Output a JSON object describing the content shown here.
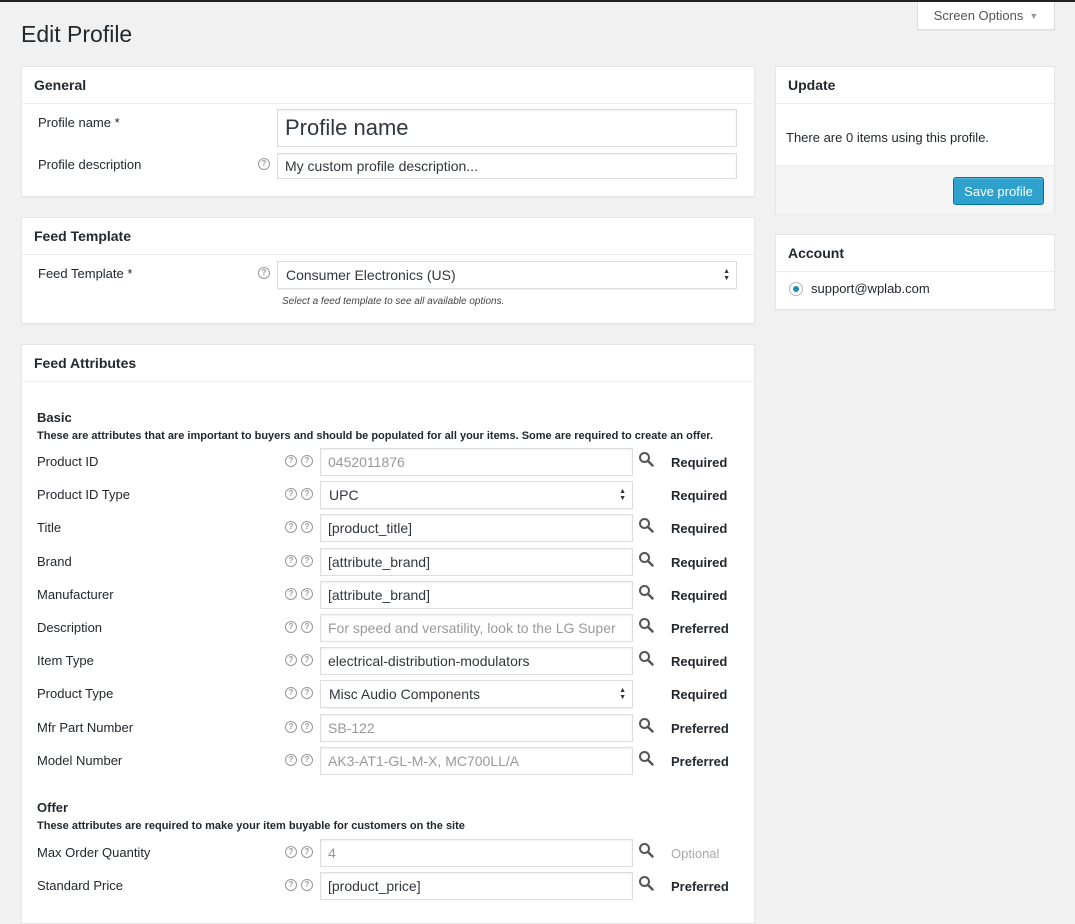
{
  "screen_options": {
    "label": "Screen Options"
  },
  "page_title": "Edit Profile",
  "general": {
    "title": "General",
    "profile_name_label": "Profile name *",
    "profile_name_placeholder": "Profile name",
    "profile_desc_label": "Profile description",
    "profile_desc_placeholder": "My custom profile description..."
  },
  "feed_template": {
    "title": "Feed Template",
    "label": "Feed Template *",
    "selected": "Consumer Electronics (US)",
    "hint": "Select a feed template to see all available options."
  },
  "feed_attributes": {
    "title": "Feed Attributes",
    "basic_title": "Basic",
    "basic_desc": "These are attributes that are important to buyers and should be populated for all your items. Some are required to create an offer.",
    "basic_rows": [
      {
        "label": "Product ID",
        "value": "0452011876",
        "placeholder": true,
        "type": "input",
        "status": "Required"
      },
      {
        "label": "Product ID Type",
        "value": "UPC",
        "placeholder": false,
        "type": "select",
        "status": "Required"
      },
      {
        "label": "Title",
        "value": "[product_title]",
        "placeholder": false,
        "type": "input",
        "status": "Required"
      },
      {
        "label": "Brand",
        "value": "[attribute_brand]",
        "placeholder": false,
        "type": "input",
        "status": "Required"
      },
      {
        "label": "Manufacturer",
        "value": "[attribute_brand]",
        "placeholder": false,
        "type": "input",
        "status": "Required"
      },
      {
        "label": "Description",
        "value": "For speed and versatility, look to the LG Super",
        "placeholder": true,
        "type": "input",
        "status": "Preferred"
      },
      {
        "label": "Item Type",
        "value": "electrical-distribution-modulators",
        "placeholder": false,
        "type": "input",
        "status": "Required"
      },
      {
        "label": "Product Type",
        "value": "Misc Audio Components",
        "placeholder": false,
        "type": "select",
        "status": "Required"
      },
      {
        "label": "Mfr Part Number",
        "value": "SB-122",
        "placeholder": true,
        "type": "input",
        "status": "Preferred"
      },
      {
        "label": "Model Number",
        "value": "AK3-AT1-GL-M-X, MC700LL/A",
        "placeholder": true,
        "type": "input",
        "status": "Preferred"
      }
    ],
    "offer_title": "Offer",
    "offer_desc": "These attributes are required to make your item buyable for customers on the site",
    "offer_rows": [
      {
        "label": "Max Order Quantity",
        "value": "4",
        "placeholder": true,
        "type": "input",
        "status": "Optional"
      },
      {
        "label": "Standard Price",
        "value": "[product_price]",
        "placeholder": false,
        "type": "input",
        "status": "Preferred"
      }
    ]
  },
  "update": {
    "title": "Update",
    "message": "There are 0 items using this profile.",
    "save_label": "Save profile"
  },
  "account": {
    "title": "Account",
    "email": "support@wplab.com"
  },
  "colors": {
    "primary_button": "#2ea2cc",
    "background": "#f1f1f1"
  }
}
